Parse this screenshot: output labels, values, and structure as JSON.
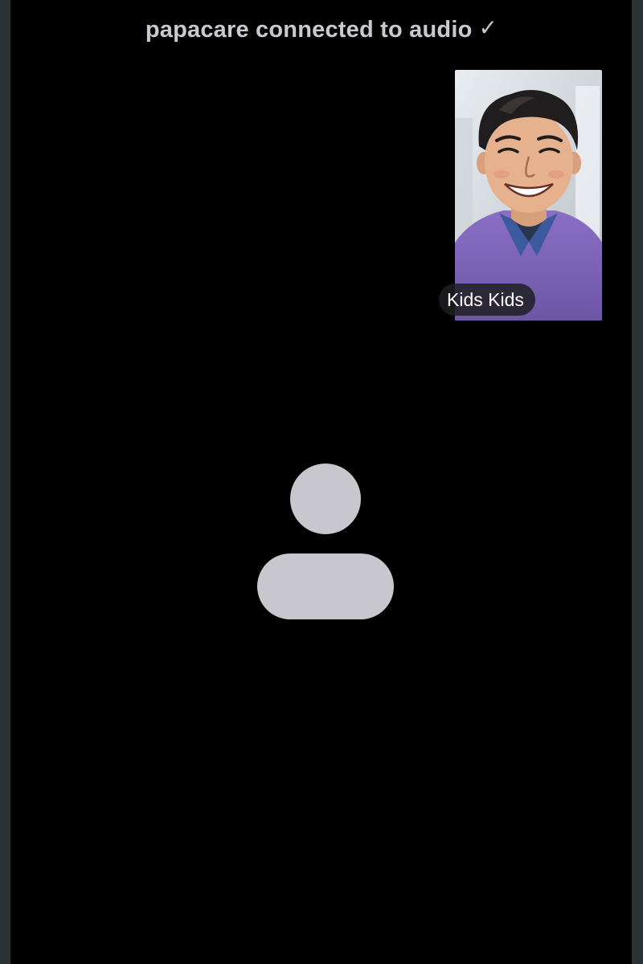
{
  "call": {
    "status_text": "papacare connected to audio",
    "status_icon": "checkmark-icon",
    "status_check_glyph": "✓"
  },
  "self_view": {
    "participant_label": "Kids Kids",
    "image": "cartoon-portrait-smiling-man-purple-sweater"
  },
  "remote_participant": {
    "avatar_icon": "person-placeholder-icon",
    "avatar_color": "#c8c7cd"
  },
  "colors": {
    "background": "#000000",
    "frame": "#2b3235",
    "status_text": "#c9c9ce"
  }
}
